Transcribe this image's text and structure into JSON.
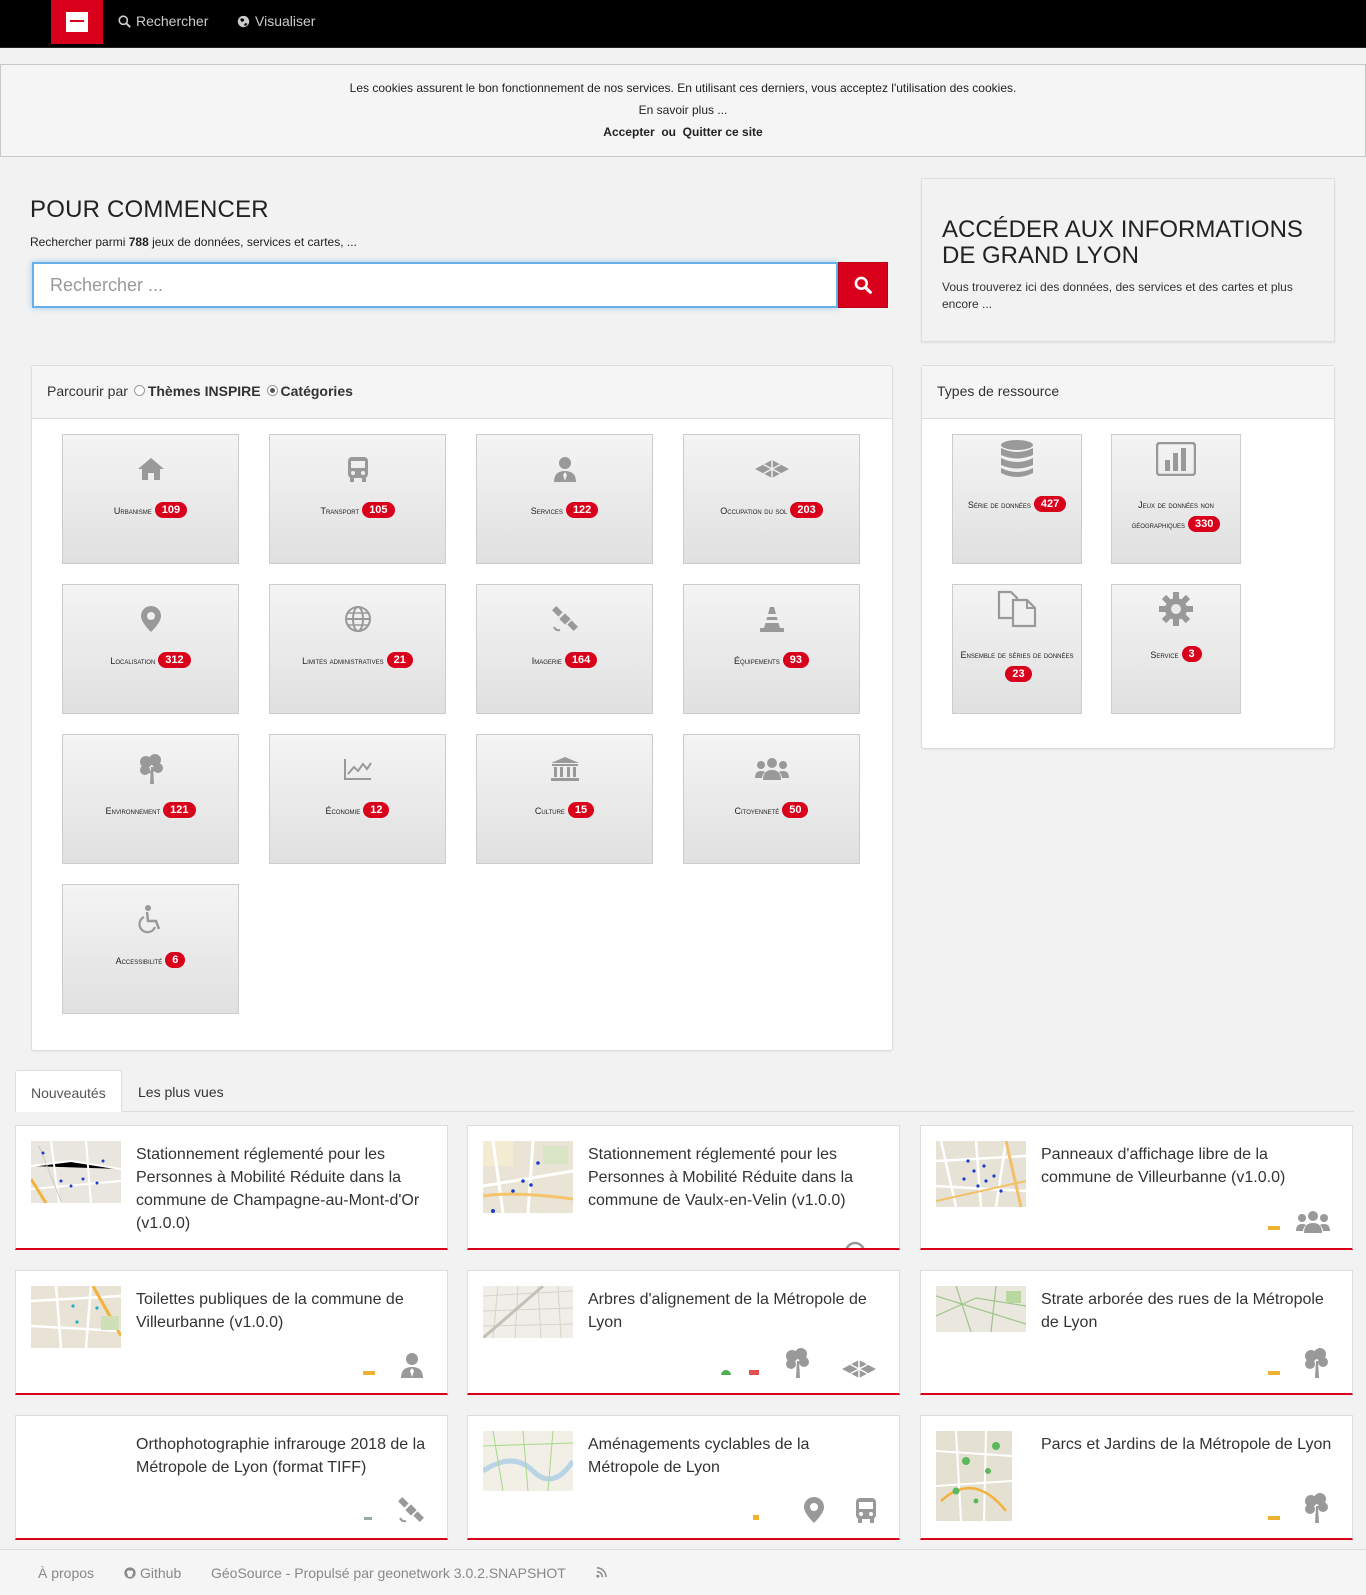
{
  "nav": {
    "search_label": "Rechercher",
    "visualize_label": "Visualiser"
  },
  "cookie": {
    "message": "Les cookies assurent le bon fonctionnement de nos services. En utilisant ces derniers, vous acceptez l'utilisation des cookies.",
    "learn_more": "En savoir plus ...",
    "accept": "Accepter",
    "or": "ou",
    "quit": "Quitter ce site"
  },
  "start": {
    "title": "POUR COMMENCER",
    "sub_prefix": "Rechercher parmi",
    "count": "788",
    "sub_suffix": "jeux de données, services et cartes, ...",
    "placeholder": "Rechercher ..."
  },
  "access": {
    "title": "ACCÉDER AUX INFORMATIONS DE GRAND LYON",
    "text": "Vous trouverez ici des données, des services et des cartes et plus encore ..."
  },
  "browse": {
    "prefix": "Parcourir par",
    "option1": "Thèmes INSPIRE",
    "option2": "Catégories",
    "categories": [
      {
        "label": "Urbanisme",
        "count": "109",
        "icon": "home-icon"
      },
      {
        "label": "Transport",
        "count": "105",
        "icon": "bus-icon"
      },
      {
        "label": "Services",
        "count": "122",
        "icon": "user-tie-icon"
      },
      {
        "label": "Occupation du sol",
        "count": "203",
        "icon": "layers-icon"
      },
      {
        "label": "Localisation",
        "count": "312",
        "icon": "map-marker-icon"
      },
      {
        "label": "Limites administratives",
        "count": "21",
        "icon": "globe-icon"
      },
      {
        "label": "Imagerie",
        "count": "164",
        "icon": "satellite-icon"
      },
      {
        "label": "Équipements",
        "count": "93",
        "icon": "cone-icon"
      },
      {
        "label": "Environnement",
        "count": "121",
        "icon": "tree-icon"
      },
      {
        "label": "Économie",
        "count": "12",
        "icon": "line-chart-icon"
      },
      {
        "label": "Culture",
        "count": "15",
        "icon": "museum-icon"
      },
      {
        "label": "Citoyenneté",
        "count": "50",
        "icon": "users-icon"
      },
      {
        "label": "Accessibilité",
        "count": "6",
        "icon": "wheelchair-icon"
      }
    ]
  },
  "types": {
    "header": "Types de ressource",
    "items": [
      {
        "label": "Série de données",
        "count": "427",
        "icon": "database-icon"
      },
      {
        "label": "Jeux de données non géographiques",
        "count": "330",
        "icon": "bar-chart-icon"
      },
      {
        "label": "Ensemble de séries de données",
        "count": "23",
        "icon": "files-icon"
      },
      {
        "label": "Service",
        "count": "3",
        "icon": "gear-icon"
      }
    ]
  },
  "tabs": {
    "new": "Nouveautés",
    "most_viewed": "Les plus vues"
  },
  "cards": [
    {
      "title": "Stationnement réglementé pour les Personnes à Mobilité Réduite dans la commune de Champagne-au-Mont-d'Or (v1.0.0)",
      "icons": []
    },
    {
      "title": "Stationnement réglementé pour les Personnes à Mobilité Réduite dans la commune de Vaulx-en-Velin (v1.0.0)",
      "icons": []
    },
    {
      "title": "Panneaux d'affichage libre de la commune de Villeurbanne (v1.0.0)",
      "icons": [
        "users-icon"
      ]
    },
    {
      "title": "Toilettes publiques de la commune de Villeurbanne (v1.0.0)",
      "icons": [
        "user-tie-icon"
      ]
    },
    {
      "title": "Arbres d'alignement de la Métropole de Lyon",
      "icons": [
        "tree-icon",
        "layers-icon"
      ]
    },
    {
      "title": "Strate arborée des rues de la Métropole de Lyon",
      "icons": [
        "tree-icon"
      ]
    },
    {
      "title": "Orthophotographie infrarouge 2018 de la Métropole de Lyon (format TIFF)",
      "icons": [
        "satellite-icon"
      ]
    },
    {
      "title": "Aménagements cyclables de la Métropole de Lyon",
      "icons": [
        "map-marker-icon",
        "bus-icon"
      ]
    },
    {
      "title": "Parcs et Jardins de la Métropole de Lyon",
      "icons": [
        "tree-icon"
      ]
    }
  ],
  "footer": {
    "about": "À propos",
    "github": "Github",
    "powered": "GéoSource - Propulsé par geonetwork 3.0.2.SNAPSHOT"
  }
}
